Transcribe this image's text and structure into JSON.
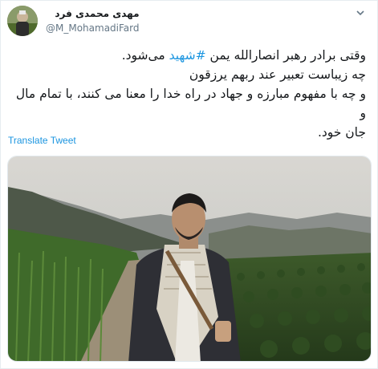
{
  "author": {
    "display_name": "مهدی محمدی فرد",
    "handle": "@M_MohamadiFard"
  },
  "tweet": {
    "line1_before": "وقتی برادر رهبر انصارالله یمن ",
    "hashtag": "#شهید",
    "line1_after": " می‌شود.",
    "line2": "چه زیباست تعبیر عند ربهم یرزقون",
    "line3": "و چه با مفهوم مبارزه و جهاد در راه خدا را معنا می کنند، با تمام مال و",
    "line4": "جان خود."
  },
  "actions": {
    "translate_label": "Translate Tweet"
  },
  "icons": {
    "menu": "chevron-down-icon"
  },
  "colors": {
    "link": "#1b95e0",
    "secondary_text": "#657786"
  }
}
